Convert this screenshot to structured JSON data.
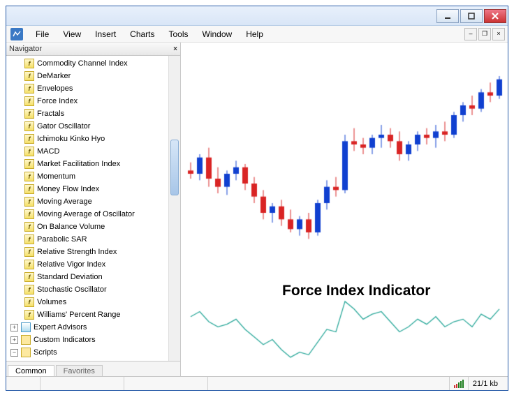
{
  "window": {
    "minimize": "",
    "maximize": "",
    "close": ""
  },
  "menubar": {
    "items": [
      "File",
      "View",
      "Insert",
      "Charts",
      "Tools",
      "Window",
      "Help"
    ]
  },
  "navigator": {
    "title": "Navigator",
    "tabs": {
      "common": "Common",
      "favorites": "Favorites"
    },
    "activeTab": "common",
    "indicators": [
      "Commodity Channel Index",
      "DeMarker",
      "Envelopes",
      "Force Index",
      "Fractals",
      "Gator Oscillator",
      "Ichimoku Kinko Hyo",
      "MACD",
      "Market Facilitation Index",
      "Momentum",
      "Money Flow Index",
      "Moving Average",
      "Moving Average of Oscillator",
      "On Balance Volume",
      "Parabolic SAR",
      "Relative Strength Index",
      "Relative Vigor Index",
      "Standard Deviation",
      "Stochastic Oscillator",
      "Volumes",
      "Williams' Percent Range"
    ],
    "roots": {
      "expertAdvisors": "Expert Advisors",
      "customIndicators": "Custom Indicators",
      "scripts": "Scripts"
    }
  },
  "chart": {
    "overlayLabel": "Force Index Indicator"
  },
  "statusbar": {
    "traffic": "21/1 kb"
  },
  "chart_data": [
    {
      "type": "candlestick",
      "title": "",
      "notes": "OHLC values estimated from pixel heights; no axis labels visible",
      "series": [
        {
          "o": 50,
          "h": 55,
          "l": 45,
          "c": 48,
          "color": "red"
        },
        {
          "o": 48,
          "h": 60,
          "l": 44,
          "c": 58,
          "color": "blue"
        },
        {
          "o": 58,
          "h": 64,
          "l": 40,
          "c": 45,
          "color": "red"
        },
        {
          "o": 45,
          "h": 52,
          "l": 36,
          "c": 40,
          "color": "red"
        },
        {
          "o": 40,
          "h": 50,
          "l": 35,
          "c": 48,
          "color": "blue"
        },
        {
          "o": 48,
          "h": 56,
          "l": 44,
          "c": 52,
          "color": "blue"
        },
        {
          "o": 52,
          "h": 54,
          "l": 38,
          "c": 42,
          "color": "red"
        },
        {
          "o": 42,
          "h": 46,
          "l": 30,
          "c": 34,
          "color": "red"
        },
        {
          "o": 34,
          "h": 38,
          "l": 20,
          "c": 24,
          "color": "red"
        },
        {
          "o": 24,
          "h": 30,
          "l": 18,
          "c": 28,
          "color": "blue"
        },
        {
          "o": 28,
          "h": 32,
          "l": 16,
          "c": 20,
          "color": "red"
        },
        {
          "o": 20,
          "h": 26,
          "l": 12,
          "c": 14,
          "color": "red"
        },
        {
          "o": 14,
          "h": 22,
          "l": 10,
          "c": 20,
          "color": "blue"
        },
        {
          "o": 20,
          "h": 24,
          "l": 8,
          "c": 12,
          "color": "red"
        },
        {
          "o": 12,
          "h": 32,
          "l": 10,
          "c": 30,
          "color": "blue"
        },
        {
          "o": 30,
          "h": 44,
          "l": 26,
          "c": 40,
          "color": "blue"
        },
        {
          "o": 40,
          "h": 46,
          "l": 34,
          "c": 38,
          "color": "red"
        },
        {
          "o": 38,
          "h": 72,
          "l": 36,
          "c": 68,
          "color": "blue"
        },
        {
          "o": 68,
          "h": 76,
          "l": 62,
          "c": 66,
          "color": "red"
        },
        {
          "o": 66,
          "h": 70,
          "l": 60,
          "c": 64,
          "color": "red"
        },
        {
          "o": 64,
          "h": 72,
          "l": 60,
          "c": 70,
          "color": "blue"
        },
        {
          "o": 70,
          "h": 78,
          "l": 64,
          "c": 72,
          "color": "blue"
        },
        {
          "o": 72,
          "h": 76,
          "l": 64,
          "c": 68,
          "color": "red"
        },
        {
          "o": 68,
          "h": 74,
          "l": 56,
          "c": 60,
          "color": "red"
        },
        {
          "o": 60,
          "h": 68,
          "l": 56,
          "c": 66,
          "color": "blue"
        },
        {
          "o": 66,
          "h": 74,
          "l": 62,
          "c": 72,
          "color": "blue"
        },
        {
          "o": 72,
          "h": 76,
          "l": 66,
          "c": 70,
          "color": "red"
        },
        {
          "o": 70,
          "h": 78,
          "l": 64,
          "c": 74,
          "color": "blue"
        },
        {
          "o": 74,
          "h": 80,
          "l": 68,
          "c": 72,
          "color": "red"
        },
        {
          "o": 72,
          "h": 86,
          "l": 70,
          "c": 84,
          "color": "blue"
        },
        {
          "o": 84,
          "h": 92,
          "l": 80,
          "c": 90,
          "color": "blue"
        },
        {
          "o": 90,
          "h": 96,
          "l": 84,
          "c": 88,
          "color": "red"
        },
        {
          "o": 88,
          "h": 100,
          "l": 86,
          "c": 98,
          "color": "blue"
        },
        {
          "o": 98,
          "h": 104,
          "l": 92,
          "c": 96,
          "color": "red"
        },
        {
          "o": 96,
          "h": 108,
          "l": 94,
          "c": 106,
          "color": "blue"
        }
      ],
      "ylim": [
        0,
        120
      ]
    },
    {
      "type": "line",
      "title": "Force Index",
      "x": [
        0,
        1,
        2,
        3,
        4,
        5,
        6,
        7,
        8,
        9,
        10,
        11,
        12,
        13,
        14,
        15,
        16,
        17,
        18,
        19,
        20,
        21,
        22,
        23,
        24,
        25,
        26,
        27,
        28,
        29,
        30,
        31,
        32,
        33,
        34
      ],
      "values": [
        22,
        26,
        18,
        14,
        16,
        20,
        12,
        6,
        0,
        4,
        -4,
        -10,
        -6,
        -8,
        2,
        12,
        10,
        34,
        28,
        20,
        24,
        26,
        18,
        10,
        14,
        20,
        16,
        22,
        14,
        18,
        20,
        14,
        24,
        20,
        28
      ],
      "ylim": [
        -15,
        40
      ],
      "color": "#2aa89a"
    }
  ]
}
